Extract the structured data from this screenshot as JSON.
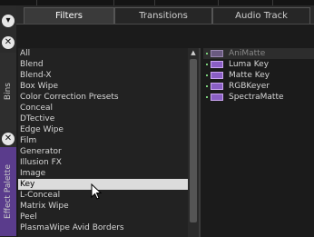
{
  "sidebar": {
    "bins_label": "Bins",
    "effect_palette_label": "Effect Palette"
  },
  "tabs": [
    {
      "label": "Filters",
      "active": true
    },
    {
      "label": "Transitions",
      "active": false
    },
    {
      "label": "Audio Track",
      "active": false
    }
  ],
  "categories": [
    "All",
    "Blend",
    "Blend-X",
    "Box Wipe",
    "Color Correction Presets",
    "Conceal",
    "DTective",
    "Edge Wipe",
    "Film",
    "Generator",
    "Illusion FX",
    "Image",
    "Key",
    "L-Conceal",
    "Matrix Wipe",
    "Peel",
    "PlasmaWipe Avid Borders"
  ],
  "selected_category": "Key",
  "effects": [
    {
      "label": "AniMatte",
      "dim": true
    },
    {
      "label": "Luma Key",
      "dim": false
    },
    {
      "label": "Matte Key",
      "dim": false
    },
    {
      "label": "RGBKeyer",
      "dim": false
    },
    {
      "label": "SpectraMatte",
      "dim": false
    }
  ],
  "colors": {
    "effect_icon": "#8a5fc4",
    "selected_row": "#dcdcdc"
  }
}
